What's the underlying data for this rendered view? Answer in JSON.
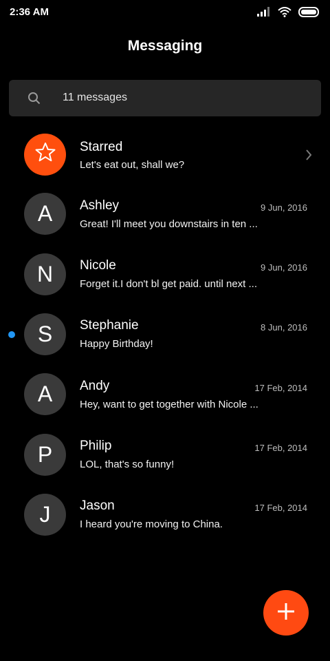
{
  "status_bar": {
    "time": "2:36 AM",
    "icons": [
      "signal-icon",
      "wifi-icon",
      "battery-icon"
    ]
  },
  "header": {
    "title": "Messaging"
  },
  "search": {
    "text": "11 messages",
    "icon": "search-icon"
  },
  "conversations": [
    {
      "name": "Starred",
      "preview": "Let's eat out, shall we?",
      "avatar": "star-icon",
      "chevron": true
    },
    {
      "name": "Ashley",
      "date": "9 Jun, 2016",
      "preview": "Great! I'll meet you downstairs in ten ...",
      "avatar_letter": "A"
    },
    {
      "name": "Nicole",
      "date": "9 Jun, 2016",
      "preview": "Forget it.I don't bl get paid. until next ...",
      "avatar_letter": "N"
    },
    {
      "name": "Stephanie",
      "date": "8 Jun, 2016",
      "preview": "Happy Birthday!",
      "avatar_letter": "S",
      "unread": true
    },
    {
      "name": "Andy",
      "date": "17 Feb, 2014",
      "preview": "Hey, want to get together with Nicole ...",
      "avatar_letter": "A"
    },
    {
      "name": "Philip",
      "date": "17 Feb, 2014",
      "preview": "LOL, that's so funny!",
      "avatar_letter": "P"
    },
    {
      "name": "Jason",
      "date": "17 Feb, 2014",
      "preview": "I heard you're moving to China.",
      "avatar_letter": "J"
    }
  ],
  "fab": {
    "icon": "plus-icon"
  },
  "colors": {
    "accent": "#ff4f0e",
    "unread_dot": "#2196f3",
    "background": "#000000",
    "avatar_bg": "#3a3a3a"
  }
}
